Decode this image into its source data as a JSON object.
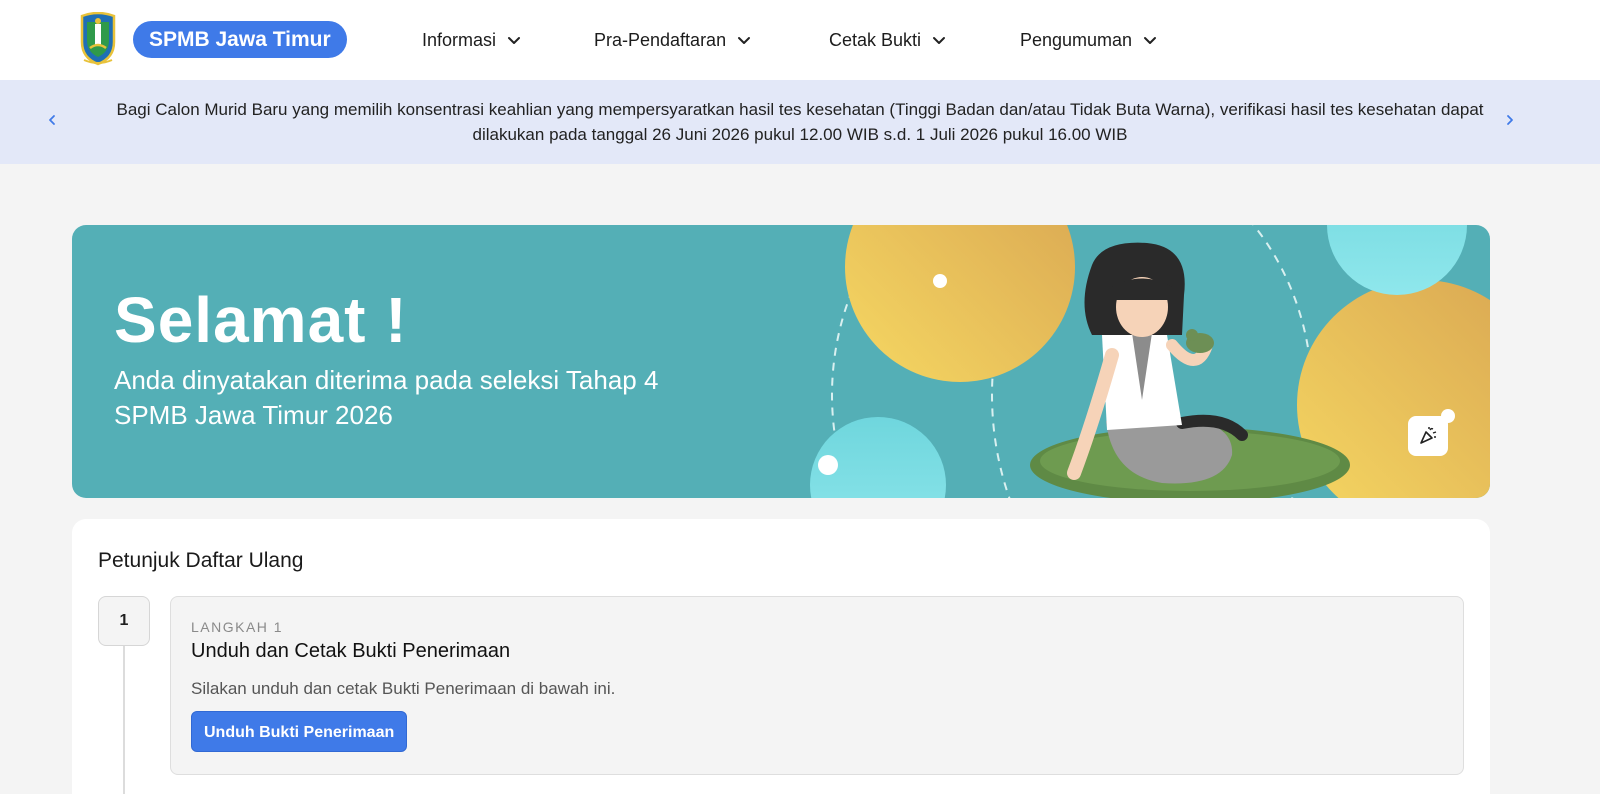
{
  "header": {
    "brand": "SPMB Jawa Timur",
    "nav": [
      {
        "label": "Informasi"
      },
      {
        "label": "Pra-Pendaftaran"
      },
      {
        "label": "Cetak Bukti"
      },
      {
        "label": "Pengumuman"
      }
    ]
  },
  "announcement": {
    "text": "Bagi Calon Murid Baru yang memilih konsentrasi keahlian yang mempersyaratkan hasil tes kesehatan (Tinggi Badan dan/atau Tidak Buta Warna), verifikasi hasil tes kesehatan dapat dilakukan pada tanggal 26 Juni 2026 pukul 12.00 WIB s.d. 1 Juli 2026 pukul 16.00 WIB"
  },
  "hero": {
    "title": "Selamat !",
    "subtitle": "Anda dinyatakan diterima pada seleksi Tahap 4 SPMB Jawa Timur 2026"
  },
  "guide": {
    "title": "Petunjuk Daftar Ulang",
    "steps": [
      {
        "number": "1",
        "label": "LANGKAH 1",
        "title": "Unduh dan Cetak Bukti Penerimaan",
        "description": "Silakan unduh dan cetak Bukti Penerimaan di bawah ini.",
        "button": "Unduh Bukti Penerimaan"
      }
    ]
  },
  "colors": {
    "brand": "#3f7ae8",
    "announce_bg": "#e3e8f8",
    "hero_bg": "#54afb6",
    "page_bg": "#f4f4f4"
  },
  "icons": [
    "province-emblem-icon",
    "chevron-down-icon",
    "chevron-left-icon",
    "chevron-right-icon",
    "confetti-icon"
  ]
}
